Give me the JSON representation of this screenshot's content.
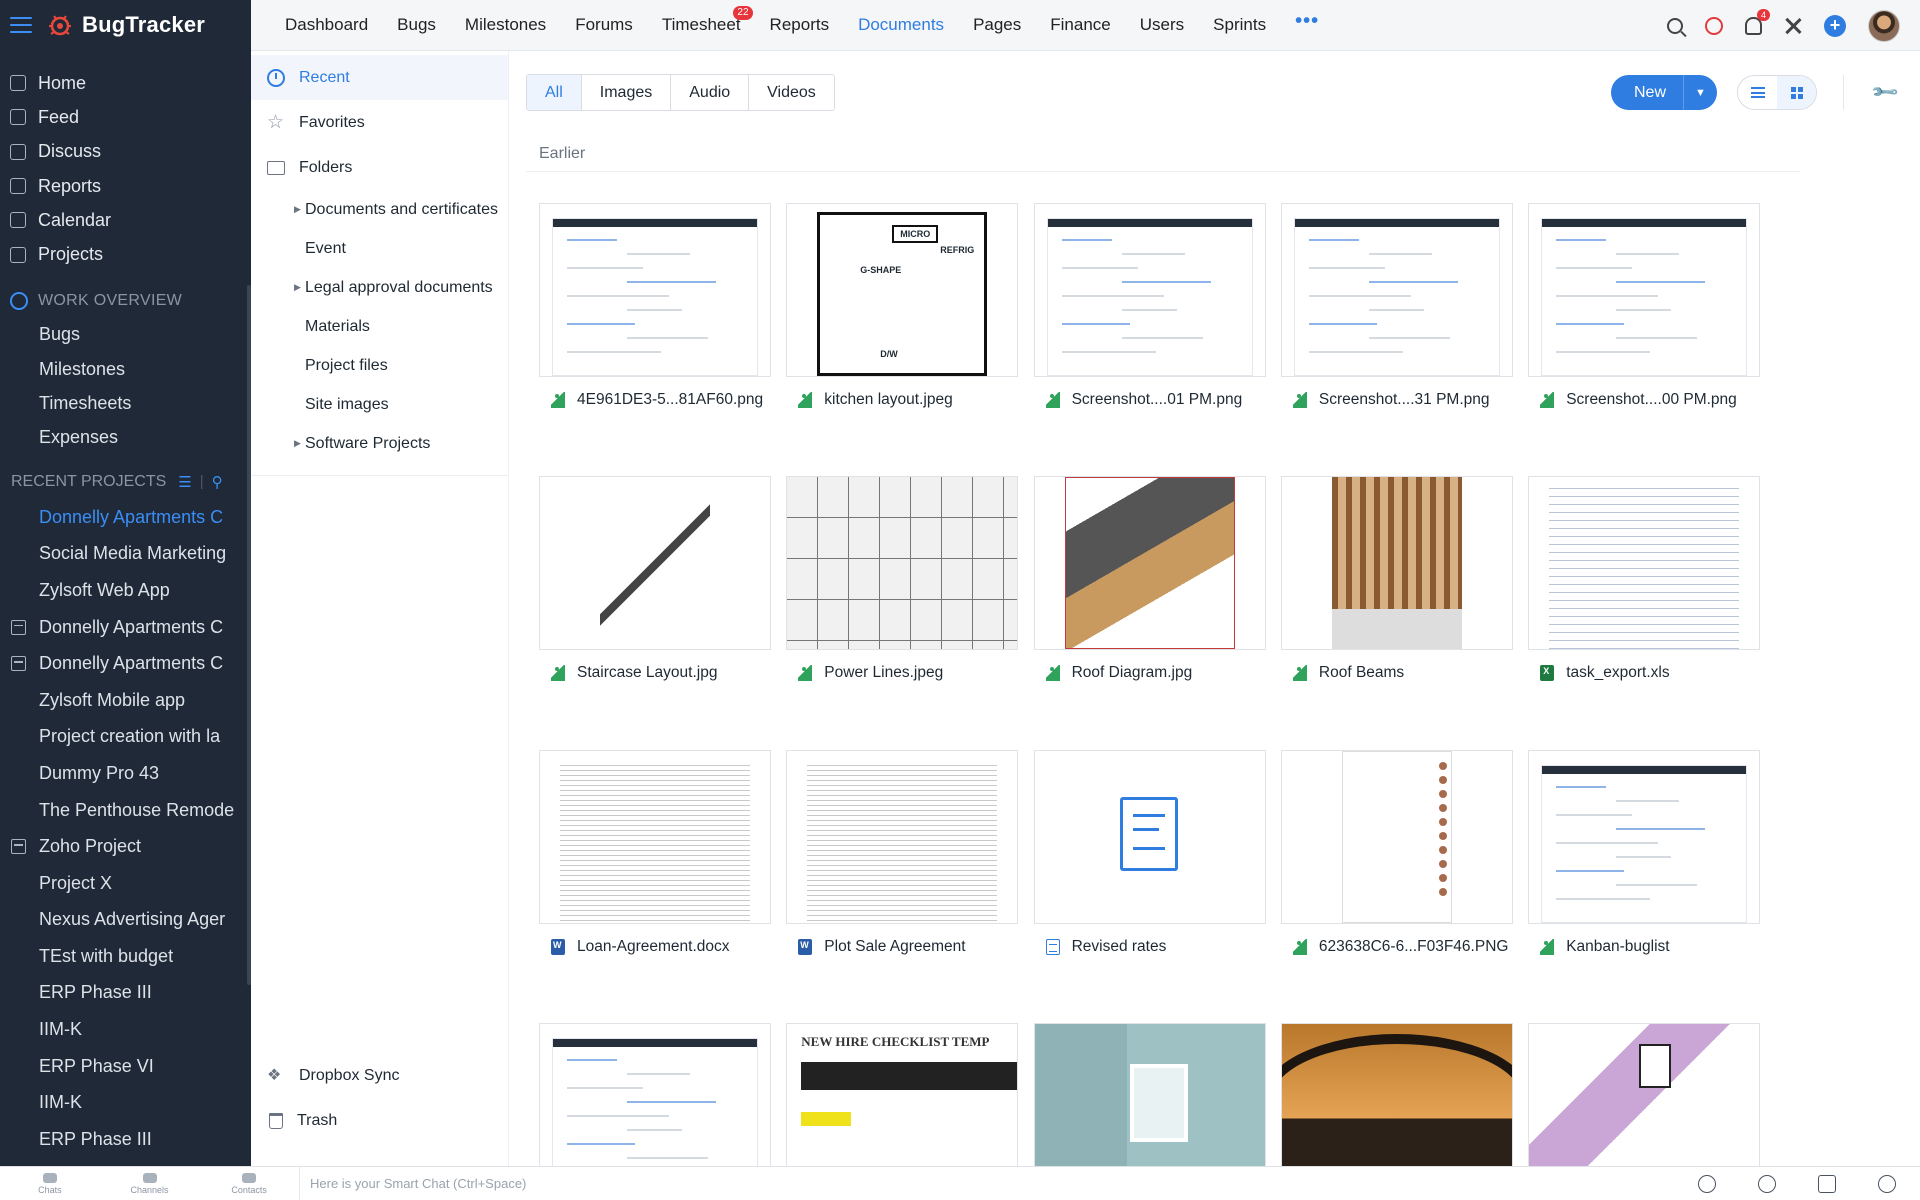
{
  "app": {
    "name": "BugTracker"
  },
  "sidebar": {
    "main_items": [
      {
        "label": "Home",
        "icon": "home-icon"
      },
      {
        "label": "Feed",
        "icon": "feed-icon"
      },
      {
        "label": "Discuss",
        "icon": "discuss-icon"
      },
      {
        "label": "Reports",
        "icon": "reports-icon"
      },
      {
        "label": "Calendar",
        "icon": "calendar-icon"
      },
      {
        "label": "Projects",
        "icon": "projects-icon"
      }
    ],
    "work_overview": {
      "heading": "WORK OVERVIEW",
      "items": [
        "Bugs",
        "Milestones",
        "Timesheets",
        "Expenses"
      ]
    },
    "recent_projects": {
      "heading": "RECENT PROJECTS",
      "items": [
        {
          "label": "Donnelly Apartments C",
          "active": true,
          "icon": false
        },
        {
          "label": "Social Media Marketing",
          "active": false,
          "icon": false
        },
        {
          "label": "Zylsoft Web App",
          "active": false,
          "icon": false
        },
        {
          "label": "Donnelly Apartments C",
          "active": false,
          "icon": true
        },
        {
          "label": "Donnelly Apartments C",
          "active": false,
          "icon": true
        },
        {
          "label": "Zylsoft Mobile app",
          "active": false,
          "icon": false
        },
        {
          "label": "Project creation with la",
          "active": false,
          "icon": false
        },
        {
          "label": "Dummy Pro 43",
          "active": false,
          "icon": false
        },
        {
          "label": "The Penthouse Remode",
          "active": false,
          "icon": false
        },
        {
          "label": "Zoho Project",
          "active": false,
          "icon": true
        },
        {
          "label": "Project X",
          "active": false,
          "icon": false
        },
        {
          "label": "Nexus Advertising Ager",
          "active": false,
          "icon": false
        },
        {
          "label": "TEst with budget",
          "active": false,
          "icon": false
        },
        {
          "label": "ERP Phase III",
          "active": false,
          "icon": false
        },
        {
          "label": "IIM-K",
          "active": false,
          "icon": false
        },
        {
          "label": "ERP Phase VI",
          "active": false,
          "icon": false
        },
        {
          "label": "IIM-K",
          "active": false,
          "icon": false
        },
        {
          "label": "ERP Phase III",
          "active": false,
          "icon": false
        }
      ]
    }
  },
  "topnav": {
    "items": [
      {
        "label": "Dashboard",
        "active": false,
        "badge": null
      },
      {
        "label": "Bugs",
        "active": false,
        "badge": null
      },
      {
        "label": "Milestones",
        "active": false,
        "badge": null
      },
      {
        "label": "Forums",
        "active": false,
        "badge": null
      },
      {
        "label": "Timesheet",
        "active": false,
        "badge": "22"
      },
      {
        "label": "Reports",
        "active": false,
        "badge": null
      },
      {
        "label": "Documents",
        "active": true,
        "badge": null
      },
      {
        "label": "Pages",
        "active": false,
        "badge": null
      },
      {
        "label": "Finance",
        "active": false,
        "badge": null
      },
      {
        "label": "Users",
        "active": false,
        "badge": null
      },
      {
        "label": "Sprints",
        "active": false,
        "badge": null
      }
    ],
    "more_label": "•••",
    "notification_count": "4",
    "add_label": "+"
  },
  "docpanel": {
    "recent": "Recent",
    "favorites": "Favorites",
    "folders": "Folders",
    "folder_items": [
      {
        "label": "Documents and certificates",
        "expandable": true
      },
      {
        "label": "Event",
        "expandable": false
      },
      {
        "label": "Legal approval documents",
        "expandable": true
      },
      {
        "label": "Materials",
        "expandable": false
      },
      {
        "label": "Project files",
        "expandable": false
      },
      {
        "label": "Site images",
        "expandable": false
      },
      {
        "label": "Software Projects",
        "expandable": true
      }
    ],
    "dropbox": "Dropbox Sync",
    "trash": "Trash"
  },
  "content": {
    "filters": [
      {
        "label": "All",
        "active": true
      },
      {
        "label": "Images",
        "active": false
      },
      {
        "label": "Audio",
        "active": false
      },
      {
        "label": "Videos",
        "active": false
      }
    ],
    "new_label": "New",
    "section_label": "Earlier",
    "files": [
      {
        "name": "4E961DE3-5...81AF60.png",
        "type": "img",
        "thumb": "ss"
      },
      {
        "name": "kitchen layout.jpeg",
        "type": "img",
        "thumb": "plan"
      },
      {
        "name": "Screenshot....01 PM.png",
        "type": "img",
        "thumb": "ss"
      },
      {
        "name": "Screenshot....31 PM.png",
        "type": "img",
        "thumb": "ss"
      },
      {
        "name": "Screenshot....00 PM.png",
        "type": "img",
        "thumb": "ss"
      },
      {
        "name": "Staircase Layout.jpg",
        "type": "img",
        "thumb": "stair"
      },
      {
        "name": "Power Lines.jpeg",
        "type": "img",
        "thumb": "wires"
      },
      {
        "name": "Roof Diagram.jpg",
        "type": "img",
        "thumb": "rdiag"
      },
      {
        "name": "Roof Beams",
        "type": "img",
        "thumb": "beams"
      },
      {
        "name": "task_export.xls",
        "type": "xls",
        "thumb": "spread"
      },
      {
        "name": "Loan-Agreement.docx",
        "type": "doc",
        "thumb": "paper"
      },
      {
        "name": "Plot Sale Agreement",
        "type": "doc",
        "thumb": "paper"
      },
      {
        "name": "Revised rates",
        "type": "zdoc",
        "thumb": "bigdoc"
      },
      {
        "name": "623638C6-6...F03F46.PNG",
        "type": "img",
        "thumb": "phone"
      },
      {
        "name": "Kanban-buglist",
        "type": "img",
        "thumb": "ss"
      },
      {
        "name": "",
        "type": "img",
        "thumb": "ss"
      },
      {
        "name": "",
        "type": "img",
        "thumb": "checklist",
        "thumb_title": "NEW HIRE CHECKLIST TEMP"
      },
      {
        "name": "",
        "type": "img",
        "thumb": "room"
      },
      {
        "name": "",
        "type": "img",
        "thumb": "sunset"
      },
      {
        "name": "",
        "type": "img",
        "thumb": "blueprint"
      }
    ]
  },
  "bottombar": {
    "tabs": [
      "Chats",
      "Channels",
      "Contacts"
    ],
    "smart_chat_placeholder": "Here is your Smart Chat (Ctrl+Space)"
  },
  "colors": {
    "accent": "#2f7de1",
    "sidebar_bg": "#1f2937",
    "badge": "#e8343b"
  }
}
